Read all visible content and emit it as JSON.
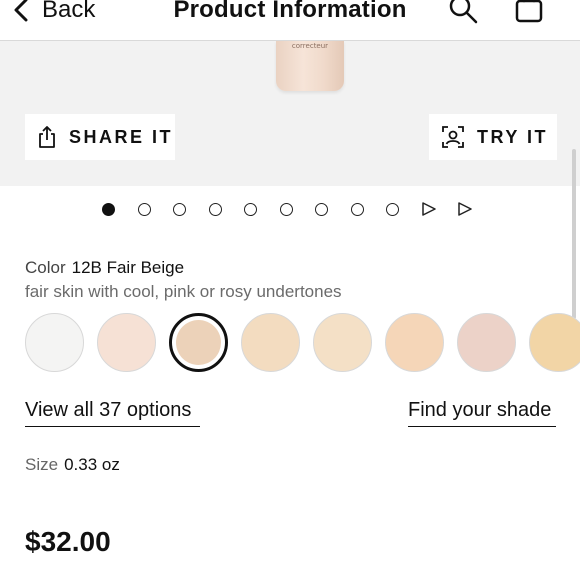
{
  "header": {
    "back_label": "Back",
    "title": "Product Information",
    "icons": [
      "chevron-left-icon",
      "search-icon",
      "shopping-bag-icon"
    ]
  },
  "hero": {
    "bottle_text": "correcteur",
    "share_label": "SHARE IT",
    "try_label": "TRY IT"
  },
  "pager": {
    "dots": 9,
    "active_index": 0,
    "video_markers": 2
  },
  "color": {
    "label": "Color",
    "value": "12B Fair Beige",
    "description": "fair skin with cool, pink or rosy undertones",
    "selected_index": 2,
    "swatches": [
      "#f4f4f3",
      "#f6e1d5",
      "#ecd2b9",
      "#f3dcc0",
      "#f4e0c6",
      "#f5d6b8",
      "#ecd2c8",
      "#f2d5a6"
    ]
  },
  "links": {
    "view_all": "View all 37 options",
    "find_shade": "Find your shade"
  },
  "size": {
    "label": "Size",
    "value": "0.33 oz"
  },
  "price": "$32.00"
}
